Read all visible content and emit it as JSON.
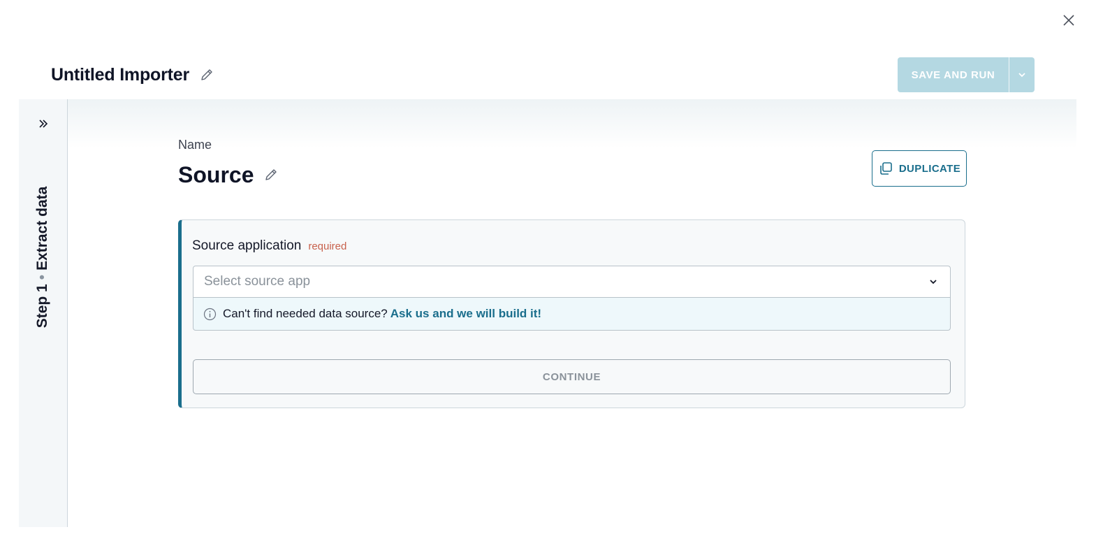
{
  "header": {
    "title": "Untitled Importer",
    "save_label": "SAVE AND RUN"
  },
  "rail": {
    "step": "Step 1",
    "separator": "•",
    "step_name": "Extract data"
  },
  "step": {
    "name_label": "Name",
    "name_value": "Source",
    "duplicate_label": "DUPLICATE"
  },
  "source_field": {
    "label": "Source application",
    "required_tag": "required",
    "placeholder": "Select source app",
    "hint_text": "Can't find needed data source?",
    "hint_link": "Ask us and we will build it!"
  },
  "actions": {
    "continue_label": "CONTINUE"
  },
  "colors": {
    "accent": "#1a6e8c",
    "save_disabled": "#b4d8e2",
    "required": "#c8624d"
  },
  "icons": [
    "close-icon",
    "pencil-icon",
    "chevron-down-icon",
    "double-chevron-right-icon",
    "copy-icon",
    "info-icon"
  ]
}
